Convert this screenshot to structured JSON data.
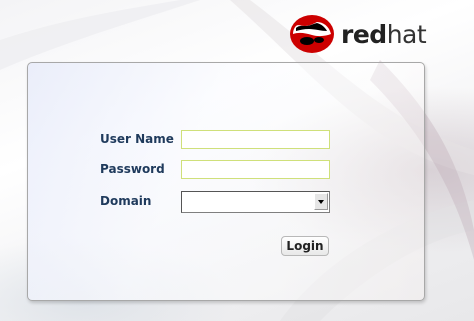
{
  "brand": {
    "logo_text_bold": "red",
    "logo_text_light": "hat",
    "logo_color": "#cc0000"
  },
  "login_form": {
    "username_label": "User Name",
    "username_value": "",
    "password_label": "Password",
    "password_value": "",
    "domain_label": "Domain",
    "domain_selected": "",
    "login_button": "Login"
  },
  "colors": {
    "label_text": "#1f3a5c",
    "input_border": "#cfe07a"
  }
}
